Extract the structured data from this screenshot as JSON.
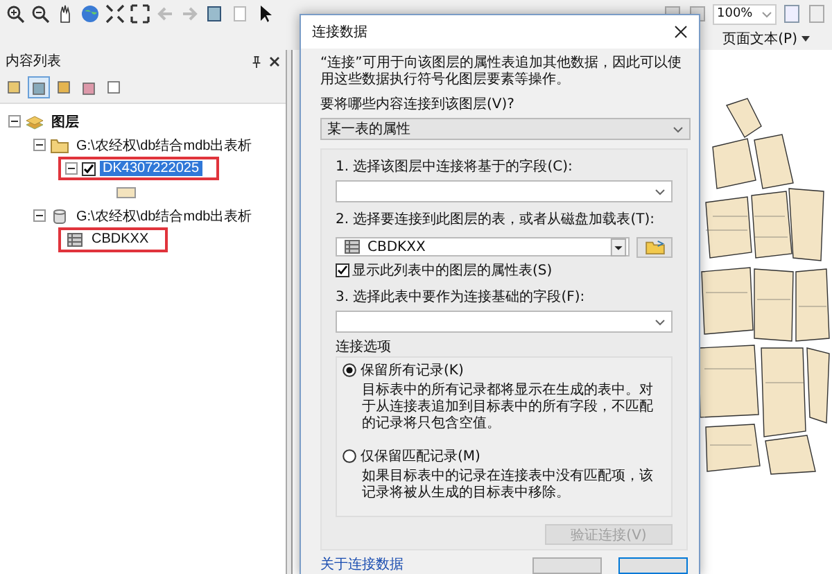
{
  "toolbar": {
    "zoom_level": "100%",
    "page_text_menu": "页面文本(P)"
  },
  "toc": {
    "title": "内容列表",
    "tree": [
      {
        "label": "图层",
        "kind": "group",
        "expanded": true,
        "selected": false,
        "highlighted": false,
        "children": [
          {
            "label": "G:\\农经权\\db结合mdb出表析",
            "kind": "folder",
            "expanded": true,
            "selected": false,
            "highlighted": false,
            "children": [
              {
                "label": "DK4307222025",
                "kind": "layer",
                "expanded": true,
                "checked": true,
                "selected": true,
                "highlighted": true
              }
            ]
          },
          {
            "label": "G:\\农经权\\db结合mdb出表析",
            "kind": "database",
            "expanded": true,
            "selected": false,
            "highlighted": false,
            "children": [
              {
                "label": "CBDKXX",
                "kind": "table",
                "selected": false,
                "highlighted": true
              }
            ]
          }
        ]
      }
    ]
  },
  "dialog": {
    "title": "连接数据",
    "intro": "“连接”可用于向该图层的属性表追加其他数据，因此可以使用这些数据执行符号化图层要素等操作。",
    "what_label": "要将哪些内容连接到该图层(V)?",
    "what_value": "某一表的属性",
    "step1_label": "1. 选择该图层中连接将基于的字段(C):",
    "step2_label": "2. 选择要连接到此图层的表，或者从磁盘加载表(T):",
    "step2_table": "CBDKXX",
    "show_layers": {
      "label": "显示此列表中的图层的属性表(S)",
      "checked": true
    },
    "step3_label": "3. 选择此表中要作为连接基础的字段(F):",
    "options_title": "连接选项",
    "options": [
      {
        "label": "保留所有记录(K)",
        "description": "目标表中的所有记录都将显示在生成的表中。对于从连接表追加到目标表中的所有字段，不匹配的记录将只包含空值。",
        "selected": true
      },
      {
        "label": "仅保留匹配记录(M)",
        "description": "如果目标表中的记录在连接表中没有匹配项，该记录将被从生成的目标表中移除。",
        "selected": false
      }
    ],
    "validate_button": {
      "label": "验证连接(V)",
      "disabled": true
    },
    "about_link": "关于连接数据"
  }
}
